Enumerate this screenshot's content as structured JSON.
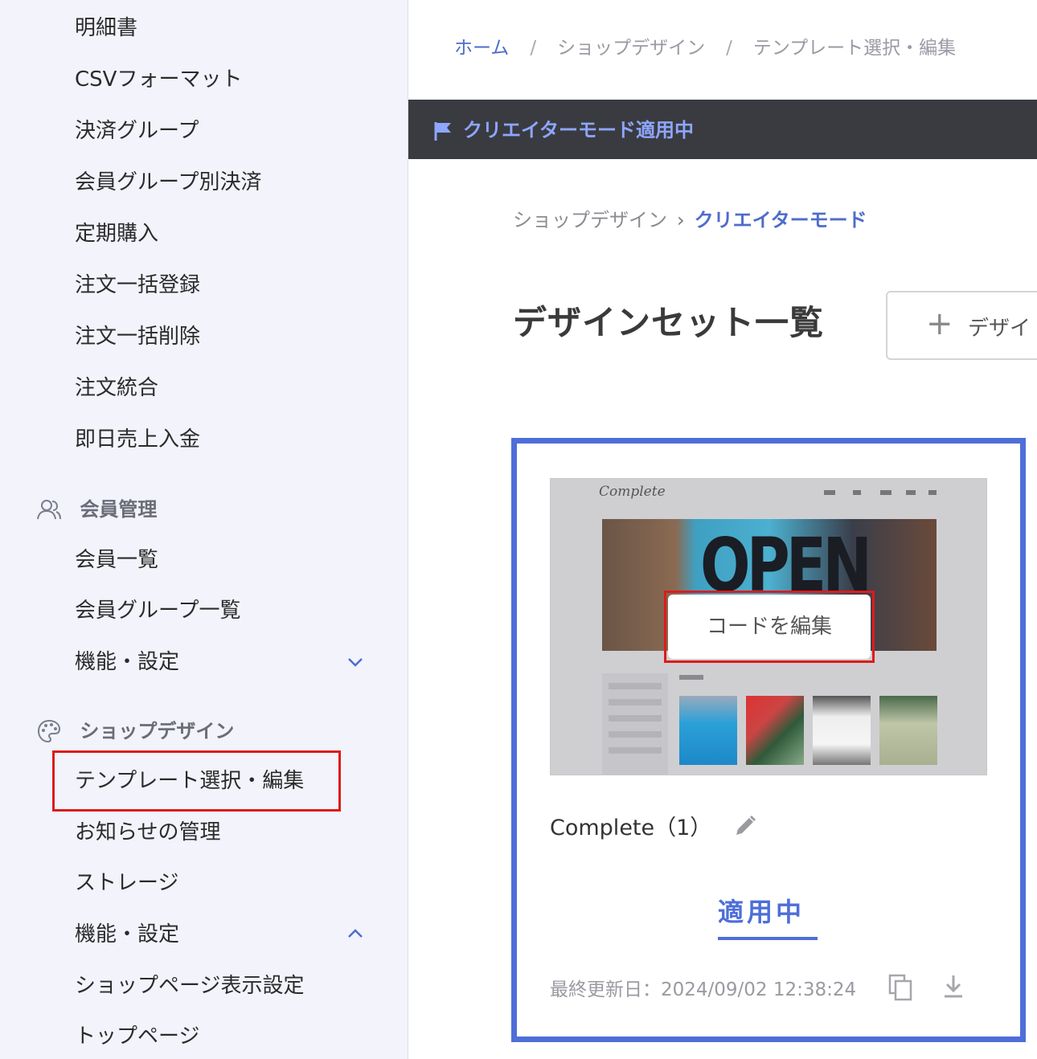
{
  "sidebar": {
    "items_top": [
      "明細書",
      "CSVフォーマット",
      "決済グループ",
      "会員グループ別決済",
      "定期購入",
      "注文一括登録",
      "注文一括削除",
      "注文統合",
      "即日売上入金"
    ],
    "member_section": {
      "title": "会員管理",
      "items": [
        "会員一覧",
        "会員グループ一覧",
        "機能・設定"
      ]
    },
    "design_section": {
      "title": "ショップデザイン",
      "items": [
        "テンプレート選択・編集",
        "お知らせの管理",
        "ストレージ",
        "機能・設定",
        "ショップページ表示設定",
        "トップページ"
      ]
    }
  },
  "breadcrumb": {
    "home": "ホーム",
    "sep": "/",
    "level1": "ショップデザイン",
    "level2": "テンプレート選択・編集"
  },
  "banner": {
    "text": "クリエイターモード適用中"
  },
  "sub_breadcrumb": {
    "parent": "ショップデザイン",
    "arrow": "›",
    "current": "クリエイターモード"
  },
  "page_title": "デザインセット一覧",
  "new_button": {
    "icon": "+",
    "label": "デザイ"
  },
  "card": {
    "thumb_logo": "Complete",
    "thumb_hero_text": "OPEN",
    "edit_code_label": "コードを編集",
    "name": "Complete（1）",
    "status": "適用中",
    "updated": "最終更新日：2024/09/02 12:38:24"
  },
  "colors": {
    "accent": "#4e6ed8",
    "highlight": "#dd1b1b",
    "banner_bg": "#3a3b40"
  }
}
